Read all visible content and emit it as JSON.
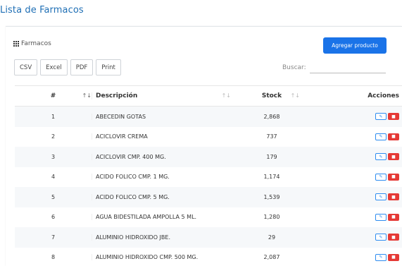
{
  "page": {
    "title": "Lista de Farmacos"
  },
  "card": {
    "label": "Farmacos",
    "label_icon": "grid-icon",
    "add_button": "Agregar producto"
  },
  "export": {
    "csv": "CSV",
    "excel": "Excel",
    "pdf": "PDF",
    "print": "Print"
  },
  "search": {
    "label": "Buscar:",
    "value": ""
  },
  "table": {
    "headers": {
      "num": "#",
      "desc": "Descripción",
      "stock": "Stock",
      "actions": "Acciones"
    },
    "rows": [
      {
        "num": "1",
        "desc": "ABECEDIN GOTAS",
        "stock": "2,868"
      },
      {
        "num": "2",
        "desc": "ACICLOVIR CREMA",
        "stock": "737"
      },
      {
        "num": "3",
        "desc": "ACICLOVIR CMP. 400 MG.",
        "stock": "179"
      },
      {
        "num": "4",
        "desc": "ACIDO FOLICO CMP. 1 MG.",
        "stock": "1,174"
      },
      {
        "num": "5",
        "desc": "ACIDO FOLICO CMP. 5 MG.",
        "stock": "1,539"
      },
      {
        "num": "6",
        "desc": "AGUA BIDESTILADA AMPOLLA 5 ML.",
        "stock": "1,280"
      },
      {
        "num": "7",
        "desc": "ALUMINIO HIDROXIDO JBE.",
        "stock": "29"
      },
      {
        "num": "8",
        "desc": "ALUMINIO HIDROXIDO CMP. 500 MG.",
        "stock": "2,087"
      }
    ]
  },
  "colors": {
    "accent": "#1a73e8",
    "title": "#1f6fb5",
    "edit": "#2d8cf0",
    "delete": "#e53935"
  }
}
